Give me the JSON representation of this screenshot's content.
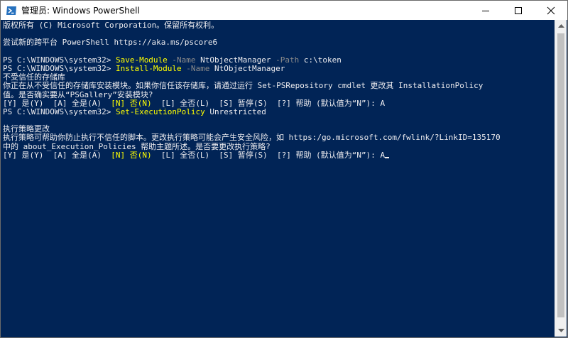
{
  "window": {
    "title": "管理员: Windows PowerShell",
    "icon": "powershell-icon",
    "background": "#012456",
    "text_color": "#eeedf0",
    "command_color": "#ffff00",
    "parameter_color": "#8a8a8a"
  },
  "controls": {
    "minimize": "minimize-icon",
    "maximize": "maximize-icon",
    "close": "close-icon"
  },
  "console": {
    "lines": [
      {
        "segments": [
          {
            "text": "版权所有 (C) Microsoft Corporation。保留所有权利。"
          }
        ]
      },
      {
        "segments": [
          {
            "text": ""
          }
        ]
      },
      {
        "segments": [
          {
            "text": "尝试新的跨平台 PowerShell https://aka.ms/pscore6"
          }
        ]
      },
      {
        "segments": [
          {
            "text": ""
          }
        ]
      },
      {
        "segments": [
          {
            "text": "PS C:\\WINDOWS\\system32> "
          },
          {
            "text": "Save-Module",
            "cls": "cmd"
          },
          {
            "text": " -Name",
            "cls": "param"
          },
          {
            "text": " NtObjectManager"
          },
          {
            "text": " -Path",
            "cls": "param"
          },
          {
            "text": " c:\\token"
          }
        ]
      },
      {
        "segments": [
          {
            "text": "PS C:\\WINDOWS\\system32> "
          },
          {
            "text": "Install-Module",
            "cls": "cmd"
          },
          {
            "text": " -Name",
            "cls": "param"
          },
          {
            "text": " NtObjectManager"
          }
        ]
      },
      {
        "segments": [
          {
            "text": "不受信任的存储库"
          }
        ]
      },
      {
        "segments": [
          {
            "text": "你正在从不受信任的存储库安装模块。如果你信任该存储库，请通过运行 Set-PSRepository cmdlet 更改其 InstallationPolicy"
          }
        ]
      },
      {
        "segments": [
          {
            "text": "值。是否确实要从“PSGallery”安装模块?"
          }
        ]
      },
      {
        "segments": [
          {
            "text": "[Y] 是(Y)  [A] 全是(A)  "
          },
          {
            "text": "[N] 否(N)",
            "cls": "hl"
          },
          {
            "text": "  [L] 全否(L)  [S] 暂停(S)  [?] 帮助 (默认值为“N”): A"
          }
        ]
      },
      {
        "segments": [
          {
            "text": "PS C:\\WINDOWS\\system32> "
          },
          {
            "text": "Set-ExecutionPolicy",
            "cls": "cmd"
          },
          {
            "text": " Unrestricted"
          }
        ]
      },
      {
        "segments": [
          {
            "text": ""
          }
        ]
      },
      {
        "segments": [
          {
            "text": "执行策略更改"
          }
        ]
      },
      {
        "segments": [
          {
            "text": "执行策略可帮助你防止执行不信任的脚本。更改执行策略可能会产生安全风险，如 https:/go.microsoft.com/fwlink/?LinkID=135170"
          }
        ]
      },
      {
        "segments": [
          {
            "text": "中的 about_Execution_Policies 帮助主题所述。是否要更改执行策略?"
          }
        ]
      },
      {
        "segments": [
          {
            "text": "[Y] 是(Y)  [A] 全是(A)  "
          },
          {
            "text": "[N] 否(N)",
            "cls": "hl"
          },
          {
            "text": "  [L] 全否(L)  [S] 暂停(S)  [?] 帮助 (默认值为“N”): A"
          }
        ],
        "cursor": true
      }
    ]
  },
  "scrollbar": {
    "up": "scroll-up-arrow-icon",
    "down": "scroll-down-arrow-icon"
  }
}
